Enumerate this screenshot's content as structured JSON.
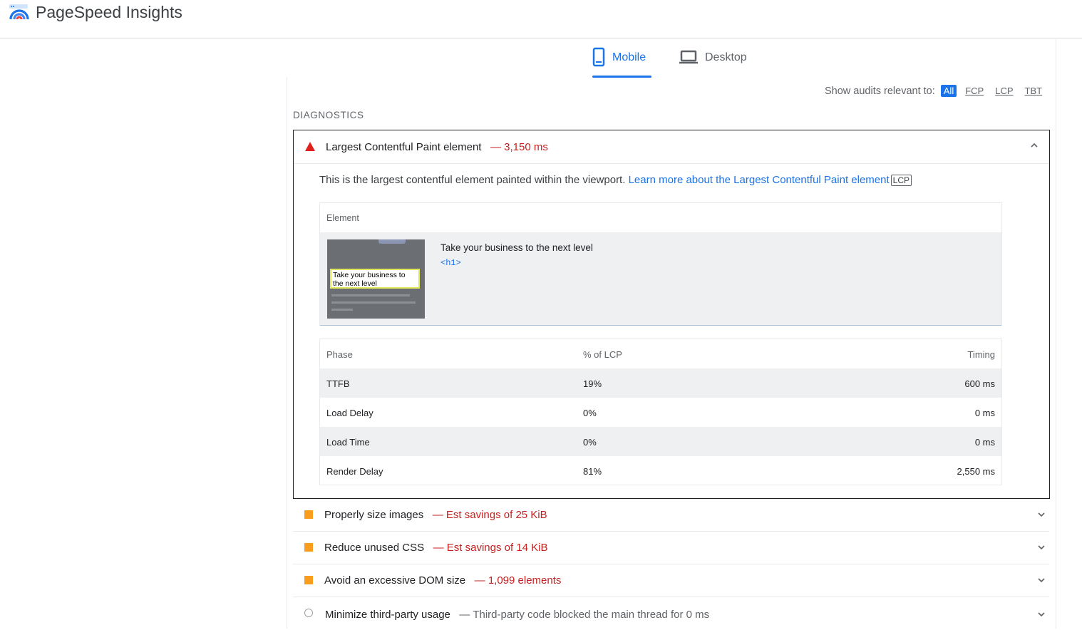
{
  "app": {
    "title": "PageSpeed Insights"
  },
  "tabs": [
    {
      "label": "Mobile",
      "active": true
    },
    {
      "label": "Desktop",
      "active": false
    }
  ],
  "filter": {
    "label": "Show audits relevant to:",
    "options": [
      "All",
      "FCP",
      "LCP",
      "TBT"
    ],
    "selected": "All"
  },
  "diagnostics": {
    "heading": "DIAGNOSTICS",
    "open_audit": {
      "title": "Largest Contentful Paint element",
      "metric": "— 3,150 ms",
      "description": "This is the largest contentful element painted within the viewport.",
      "learn_more": "Learn more about the Largest Contentful Paint element",
      "chip": "LCP",
      "element_table": {
        "header": "Element",
        "thumbnail_text": "Take your business to the next level",
        "element_text": "Take your business to the next level",
        "element_tag": "<h1>"
      },
      "phase_table": {
        "headers": [
          "Phase",
          "% of LCP",
          "Timing"
        ],
        "rows": [
          [
            "TTFB",
            "19%",
            "600 ms"
          ],
          [
            "Load Delay",
            "0%",
            "0 ms"
          ],
          [
            "Load Time",
            "0%",
            "0 ms"
          ],
          [
            "Render Delay",
            "81%",
            "2,550 ms"
          ]
        ]
      }
    },
    "audits": [
      {
        "title": "Properly size images",
        "metric": "— Est savings of 25 KiB",
        "status": "warning"
      },
      {
        "title": "Reduce unused CSS",
        "metric": "— Est savings of 14 KiB",
        "status": "warning"
      },
      {
        "title": "Avoid an excessive DOM size",
        "metric": "— 1,099 elements",
        "status": "warning"
      },
      {
        "title": "Minimize third-party usage",
        "metric": "— Third-party code blocked the main thread for 0 ms",
        "status": "informative"
      }
    ]
  },
  "colors": {
    "accent": "#1a73e8",
    "fail": "#e0201c",
    "warning": "#fa9d1d",
    "metric_red": "#c5221f"
  }
}
